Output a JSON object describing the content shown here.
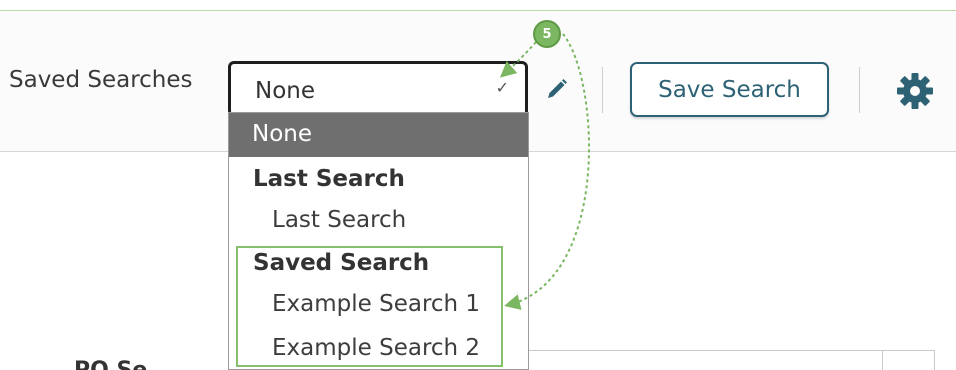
{
  "toolbar": {
    "label": "Saved Searches",
    "select_value": "None",
    "save_button": "Save Search"
  },
  "dropdown": {
    "selected": "None",
    "groups": [
      {
        "label": "Last Search",
        "options": [
          "Last Search"
        ]
      },
      {
        "label": "Saved Search",
        "options": [
          "Example Search 1",
          "Example Search 2"
        ]
      }
    ]
  },
  "background": {
    "partial_label": "PO Se"
  },
  "annotation": {
    "step": "5",
    "color": "#7bb661"
  },
  "colors": {
    "accent": "#2d6275",
    "selected_bg": "#6f6f6f",
    "highlight": "#86c06c"
  },
  "icons": {
    "edit": "pencil-icon",
    "settings": "gear-icon",
    "chevron": "chevron-down-icon"
  }
}
